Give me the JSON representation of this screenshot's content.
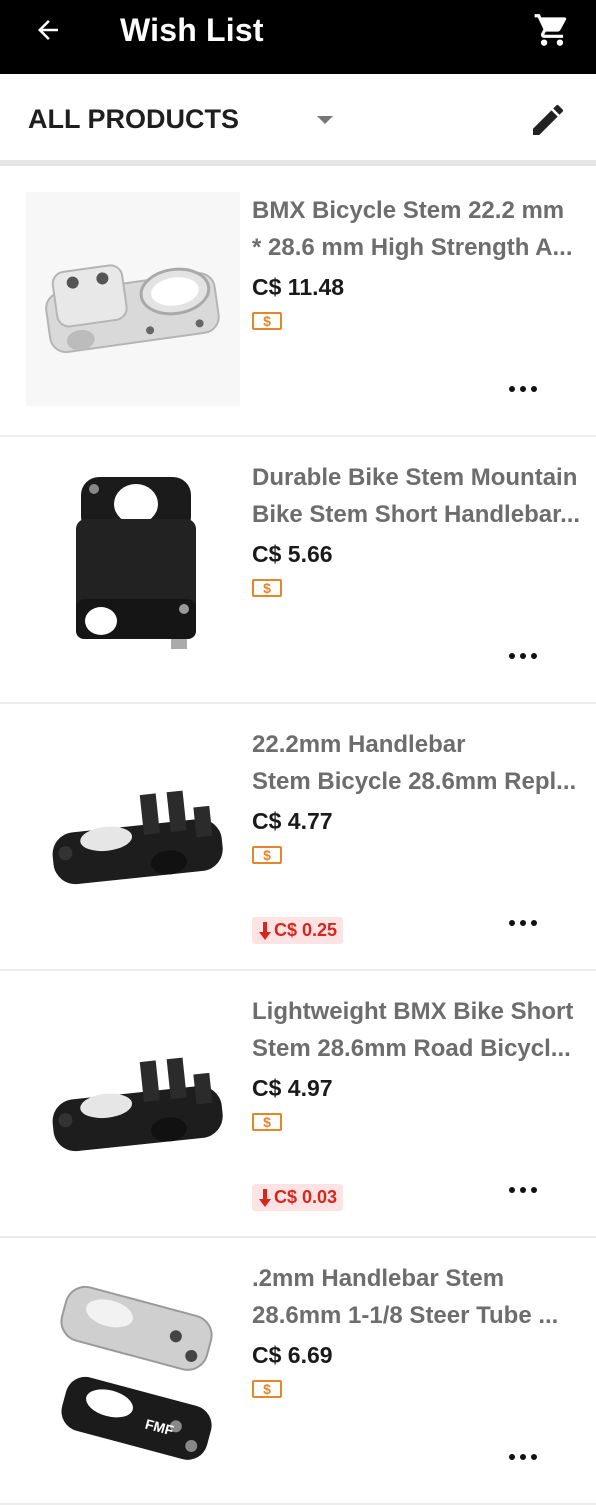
{
  "header": {
    "title": "Wish List"
  },
  "filter": {
    "label": "ALL PRODUCTS"
  },
  "items": [
    {
      "line1": "BMX Bicycle Stem 22.2 mm",
      "line2": "* 28.6 mm High Strength A...",
      "price": "C$ 11.48",
      "coupon": "$",
      "drop": ""
    },
    {
      "line1": "Durable Bike Stem Mountain",
      "line2": "Bike Stem Short Handlebar...",
      "price": "C$ 5.66",
      "coupon": "$",
      "drop": ""
    },
    {
      "line1": "22.2mm Handlebar",
      "line2": "Stem Bicycle 28.6mm Repl...",
      "price": "C$ 4.77",
      "coupon": "$",
      "drop": "C$ 0.25"
    },
    {
      "line1": "Lightweight BMX Bike Short",
      "line2": "Stem 28.6mm Road Bicycl...",
      "price": "C$ 4.97",
      "coupon": "$",
      "drop": "C$ 0.03"
    },
    {
      "line1": ".2mm Handlebar Stem",
      "line2": "28.6mm 1-1/8 Steer Tube ...",
      "price": "C$ 6.69",
      "coupon": "$",
      "drop": ""
    }
  ],
  "icons": {
    "back": "arrow-back-icon",
    "cart": "shopping-cart-icon",
    "dropdown": "caret-down-icon",
    "edit": "pencil-icon",
    "more": "more-horizontal-icon",
    "coupon": "coupon-icon",
    "price_drop": "arrow-down-icon"
  },
  "colors": {
    "appbar": "#000000",
    "coupon": "#e6862a",
    "price_drop_text": "#d7261d",
    "price_drop_bg": "#fde3e3"
  }
}
